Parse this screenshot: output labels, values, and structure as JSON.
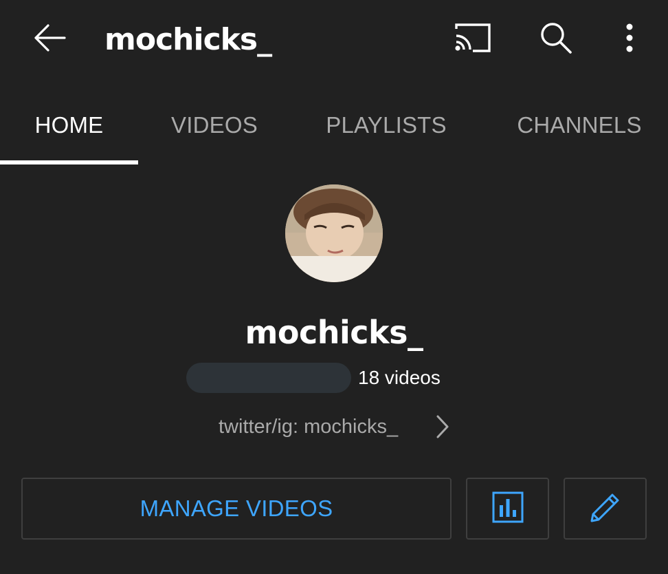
{
  "header": {
    "title": "mochicks_",
    "icons": [
      "back-arrow-icon",
      "cast-icon",
      "search-icon",
      "more-vert-icon"
    ]
  },
  "tabs": [
    {
      "label": "HOME",
      "active": true
    },
    {
      "label": "VIDEOS",
      "active": false
    },
    {
      "label": "PLAYLISTS",
      "active": false
    },
    {
      "label": "CHANNELS",
      "active": false
    }
  ],
  "channel": {
    "name": "mochicks_",
    "video_count": "18 videos",
    "description": "twitter/ig: mochicks_"
  },
  "actions": {
    "manage_label": "MANAGE VIDEOS",
    "icons": [
      "analytics-icon",
      "edit-pencil-icon"
    ]
  },
  "colors": {
    "background": "#212121",
    "accent": "#3ea6ff",
    "text_primary": "#ffffff",
    "text_secondary": "#aaaaaa",
    "button_border": "#3f3f3f"
  }
}
